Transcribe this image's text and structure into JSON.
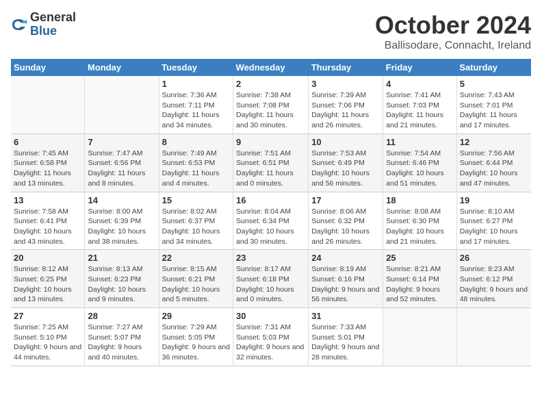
{
  "logo": {
    "general": "General",
    "blue": "Blue"
  },
  "title": "October 2024",
  "subtitle": "Ballisodare, Connacht, Ireland",
  "headers": [
    "Sunday",
    "Monday",
    "Tuesday",
    "Wednesday",
    "Thursday",
    "Friday",
    "Saturday"
  ],
  "weeks": [
    [
      {
        "day": "",
        "info": ""
      },
      {
        "day": "",
        "info": ""
      },
      {
        "day": "1",
        "info": "Sunrise: 7:36 AM\nSunset: 7:11 PM\nDaylight: 11 hours and 34 minutes."
      },
      {
        "day": "2",
        "info": "Sunrise: 7:38 AM\nSunset: 7:08 PM\nDaylight: 11 hours and 30 minutes."
      },
      {
        "day": "3",
        "info": "Sunrise: 7:39 AM\nSunset: 7:06 PM\nDaylight: 11 hours and 26 minutes."
      },
      {
        "day": "4",
        "info": "Sunrise: 7:41 AM\nSunset: 7:03 PM\nDaylight: 11 hours and 21 minutes."
      },
      {
        "day": "5",
        "info": "Sunrise: 7:43 AM\nSunset: 7:01 PM\nDaylight: 11 hours and 17 minutes."
      }
    ],
    [
      {
        "day": "6",
        "info": "Sunrise: 7:45 AM\nSunset: 6:58 PM\nDaylight: 11 hours and 13 minutes."
      },
      {
        "day": "7",
        "info": "Sunrise: 7:47 AM\nSunset: 6:56 PM\nDaylight: 11 hours and 8 minutes."
      },
      {
        "day": "8",
        "info": "Sunrise: 7:49 AM\nSunset: 6:53 PM\nDaylight: 11 hours and 4 minutes."
      },
      {
        "day": "9",
        "info": "Sunrise: 7:51 AM\nSunset: 6:51 PM\nDaylight: 11 hours and 0 minutes."
      },
      {
        "day": "10",
        "info": "Sunrise: 7:53 AM\nSunset: 6:49 PM\nDaylight: 10 hours and 56 minutes."
      },
      {
        "day": "11",
        "info": "Sunrise: 7:54 AM\nSunset: 6:46 PM\nDaylight: 10 hours and 51 minutes."
      },
      {
        "day": "12",
        "info": "Sunrise: 7:56 AM\nSunset: 6:44 PM\nDaylight: 10 hours and 47 minutes."
      }
    ],
    [
      {
        "day": "13",
        "info": "Sunrise: 7:58 AM\nSunset: 6:41 PM\nDaylight: 10 hours and 43 minutes."
      },
      {
        "day": "14",
        "info": "Sunrise: 8:00 AM\nSunset: 6:39 PM\nDaylight: 10 hours and 38 minutes."
      },
      {
        "day": "15",
        "info": "Sunrise: 8:02 AM\nSunset: 6:37 PM\nDaylight: 10 hours and 34 minutes."
      },
      {
        "day": "16",
        "info": "Sunrise: 8:04 AM\nSunset: 6:34 PM\nDaylight: 10 hours and 30 minutes."
      },
      {
        "day": "17",
        "info": "Sunrise: 8:06 AM\nSunset: 6:32 PM\nDaylight: 10 hours and 26 minutes."
      },
      {
        "day": "18",
        "info": "Sunrise: 8:08 AM\nSunset: 6:30 PM\nDaylight: 10 hours and 21 minutes."
      },
      {
        "day": "19",
        "info": "Sunrise: 8:10 AM\nSunset: 6:27 PM\nDaylight: 10 hours and 17 minutes."
      }
    ],
    [
      {
        "day": "20",
        "info": "Sunrise: 8:12 AM\nSunset: 6:25 PM\nDaylight: 10 hours and 13 minutes."
      },
      {
        "day": "21",
        "info": "Sunrise: 8:13 AM\nSunset: 6:23 PM\nDaylight: 10 hours and 9 minutes."
      },
      {
        "day": "22",
        "info": "Sunrise: 8:15 AM\nSunset: 6:21 PM\nDaylight: 10 hours and 5 minutes."
      },
      {
        "day": "23",
        "info": "Sunrise: 8:17 AM\nSunset: 6:18 PM\nDaylight: 10 hours and 0 minutes."
      },
      {
        "day": "24",
        "info": "Sunrise: 8:19 AM\nSunset: 6:16 PM\nDaylight: 9 hours and 56 minutes."
      },
      {
        "day": "25",
        "info": "Sunrise: 8:21 AM\nSunset: 6:14 PM\nDaylight: 9 hours and 52 minutes."
      },
      {
        "day": "26",
        "info": "Sunrise: 8:23 AM\nSunset: 6:12 PM\nDaylight: 9 hours and 48 minutes."
      }
    ],
    [
      {
        "day": "27",
        "info": "Sunrise: 7:25 AM\nSunset: 5:10 PM\nDaylight: 9 hours and 44 minutes."
      },
      {
        "day": "28",
        "info": "Sunrise: 7:27 AM\nSunset: 5:07 PM\nDaylight: 9 hours and 40 minutes."
      },
      {
        "day": "29",
        "info": "Sunrise: 7:29 AM\nSunset: 5:05 PM\nDaylight: 9 hours and 36 minutes."
      },
      {
        "day": "30",
        "info": "Sunrise: 7:31 AM\nSunset: 5:03 PM\nDaylight: 9 hours and 32 minutes."
      },
      {
        "day": "31",
        "info": "Sunrise: 7:33 AM\nSunset: 5:01 PM\nDaylight: 9 hours and 28 minutes."
      },
      {
        "day": "",
        "info": ""
      },
      {
        "day": "",
        "info": ""
      }
    ]
  ]
}
